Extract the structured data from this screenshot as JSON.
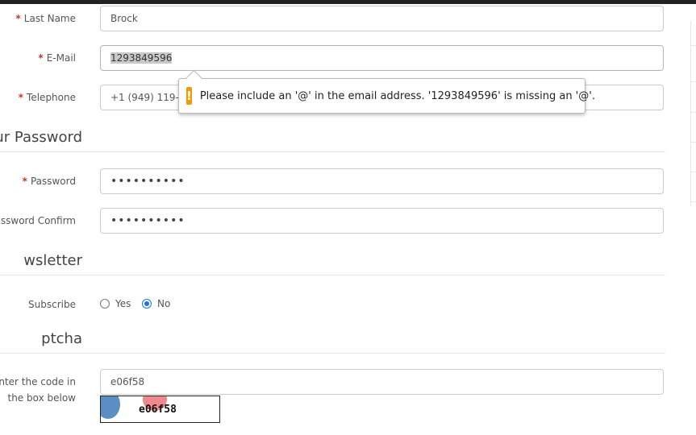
{
  "form": {
    "last_name": {
      "label": "Last Name",
      "value": "Brock"
    },
    "email": {
      "label": "E-Mail",
      "value": "1293849596"
    },
    "telephone": {
      "label": "Telephone",
      "value": "+1 (949) 119-15"
    },
    "password_section": "ur Password",
    "password": {
      "label": "Password",
      "value": "••••••••••"
    },
    "password_confirm": {
      "label": "assword Confirm",
      "value": "••••••••••"
    },
    "newsletter_section": "wsletter",
    "subscribe": {
      "label": "Subscribe",
      "options": [
        "Yes",
        "No"
      ],
      "selected": "No"
    },
    "captcha_section": "ptcha",
    "captcha": {
      "label_line1": "Enter the code in",
      "label_line2": "the box below",
      "value": "e06f58",
      "image_text": "e06f58"
    },
    "required_marker": "*"
  },
  "tooltip": {
    "icon": "warning-icon",
    "icon_glyph": "!",
    "message": "Please include an '@' in the email address. '1293849596' is missing an '@'."
  },
  "colors": {
    "required": "#c0392b",
    "radio_selected": "#1a73e8",
    "warning": "#f29900"
  }
}
